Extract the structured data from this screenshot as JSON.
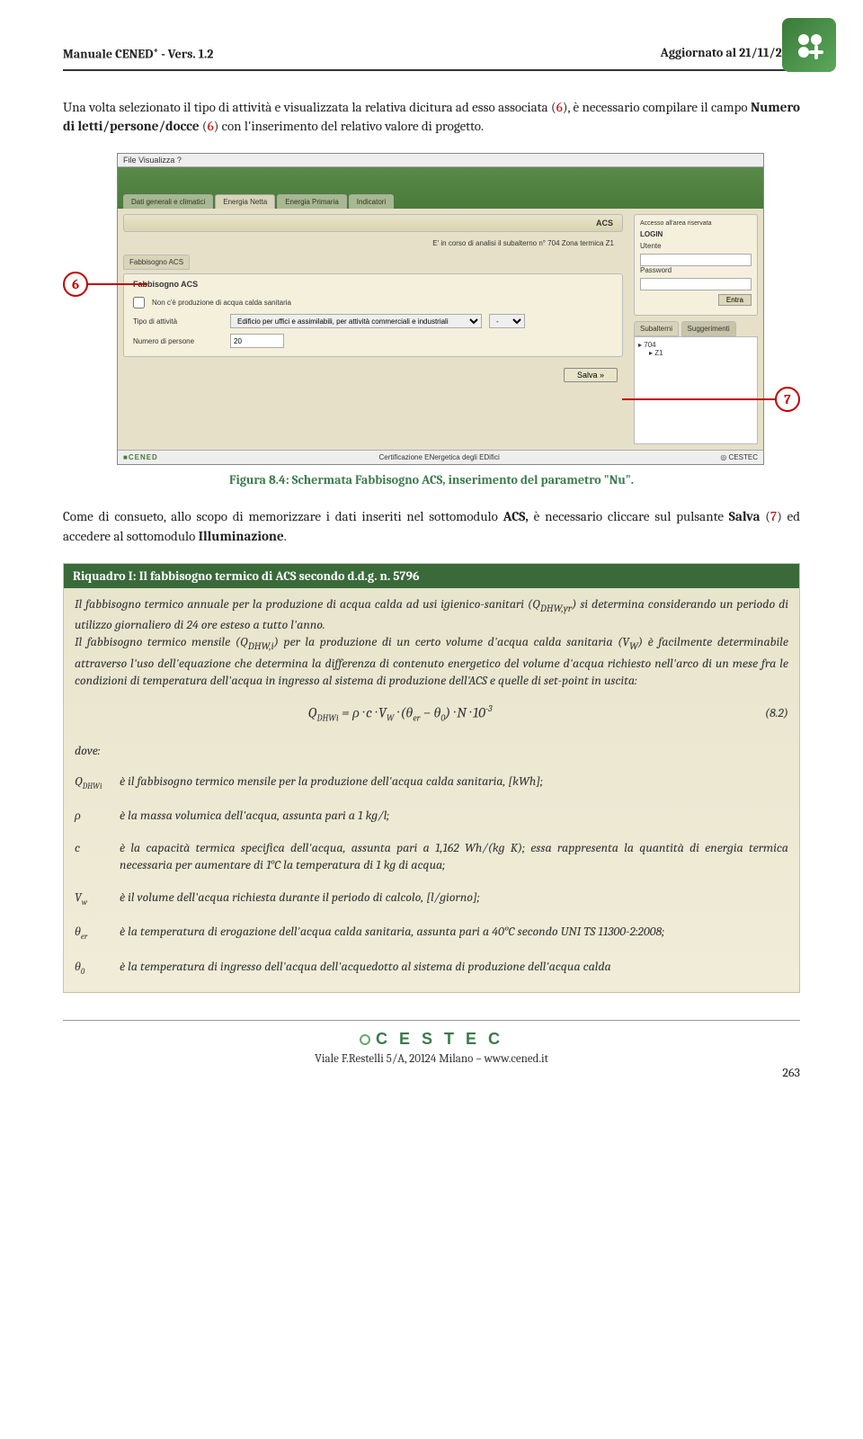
{
  "header": {
    "left": "Manuale CENED",
    "sup": "+",
    "version": " - Vers. 1.2",
    "right": "Aggiornato al 21/11/2011"
  },
  "para1_a": "Una volta selezionato il tipo di attività e visualizzata la relativa dicitura ad esso associata (",
  "para1_6": "6",
  "para1_b": "), è necessario compilare il campo ",
  "para1_bold": "Numero di letti/persone/docce",
  "para1_c": " (",
  "para1_6b": "6",
  "para1_d": ") con l'inserimento del relativo valore di progetto.",
  "callouts": {
    "six": "6",
    "seven": "7"
  },
  "screenshot": {
    "menu": "File   Visualizza   ?",
    "tabs": [
      "Dati generali e climatici",
      "Energia Netta",
      "Energia Primaria",
      "Indicatori"
    ],
    "acs_hdr": "ACS",
    "status": "E' in corso di analisi il subalterno n°  704      Zona termica  Z1",
    "side_login_title": "Accesso all'area riservata",
    "login": "LOGIN",
    "utente": "Utente",
    "password": "Password",
    "entra": "Entra",
    "leftTab": "Fabbisogno ACS",
    "panel_title": "Fabbisogno ACS",
    "checkbox": "Non c'è produzione di acqua calda sanitaria",
    "tipo_label": "Tipo di attività",
    "tipo_value": "Edificio per uffici e assimilabili, per attività commerciali e industriali",
    "num_label": "Numero di persone",
    "num_value": "20",
    "sidetabs": [
      "Subalterni",
      "Suggerimenti"
    ],
    "tree": [
      "▸ 704",
      "  ▸ Z1"
    ],
    "salva": "Salva   »",
    "footer_logo": "■CENED",
    "footer_center": "Certificazione ENergetica degli EDifici",
    "footer_right": "◎ CESTEC"
  },
  "fig_caption": "Figura 8.4: Schermata Fabbisogno ACS, inserimento del parametro \"Nu\".",
  "para2_a": "Come di consueto, allo scopo di memorizzare i dati inseriti nel sottomodulo ",
  "para2_bold1": "ACS,",
  "para2_b": " è necessario cliccare sul pulsante ",
  "para2_bold2": "Salva",
  "para2_c": " (",
  "para2_7": "7",
  "para2_d": ") ed accedere al sottomodulo ",
  "para2_bold3": "Illuminazione",
  "para2_e": ".",
  "riquadro_hdr": "Riquadro I: Il fabbisogno termico di ACS secondo d.d.g. n. 5796",
  "riquadro_p1": "Il fabbisogno termico annuale per la produzione di acqua calda ad usi igienico-sanitari (Q",
  "riquadro_p1sub": "DHW,yr",
  "riquadro_p1b": ") si determina considerando un periodo di utilizzo giornaliero di 24 ore esteso a tutto l'anno.",
  "riquadro_p2": "Il fabbisogno termico mensile (Q",
  "riquadro_p2sub": "DHW,i",
  "riquadro_p2b": ") per la produzione di un certo volume d'acqua calda sanitaria (V",
  "riquadro_p2sub2": "W",
  "riquadro_p2c": ") è facilmente determinabile attraverso l'uso dell'equazione che determina la differenza di contenuto energetico del volume d'acqua richiesto nell'arco di un mese fra le condizioni di temperatura dell'acqua in ingresso al sistema di produzione dell'ACS e quelle di set-point in uscita:",
  "formula": "Q_{DHWi} = ρ · c · V_W · (θ_{er} - θ_0) · N · 10^{-3}",
  "eqnum": "(8.2)",
  "dove": "dove:",
  "defs": [
    {
      "sym": "Q",
      "sub": "DHWi",
      "txt": "è il fabbisogno termico mensile per la produzione dell'acqua calda sanitaria, [kWh];"
    },
    {
      "sym": "ρ",
      "sub": "",
      "txt": "è la massa volumica dell'acqua, assunta pari a 1 kg/l;"
    },
    {
      "sym": "c",
      "sub": "",
      "txt": "è la capacità termica specifica dell'acqua, assunta pari a 1,162 Wh/(kg K); essa rappresenta la quantità di energia termica necessaria per aumentare di 1°C la temperatura di 1 kg di acqua;"
    },
    {
      "sym": "V",
      "sub": "w",
      "txt": "è il volume dell'acqua richiesta durante il periodo di calcolo, [l/giorno];"
    },
    {
      "sym": "θ",
      "sub": "er",
      "txt": "è la temperatura di erogazione dell'acqua calda sanitaria, assunta pari a 40°C secondo UNI TS 11300-2:2008;"
    },
    {
      "sym": "θ",
      "sub": "0",
      "txt": "è la temperatura di ingresso dell'acqua dell'acquedotto al sistema di produzione dell'acqua calda"
    }
  ],
  "footer": {
    "logo": "C E S T E C",
    "addr": "Viale F.Restelli 5/A, 20124 Milano – www.cened.it",
    "page": "263"
  }
}
